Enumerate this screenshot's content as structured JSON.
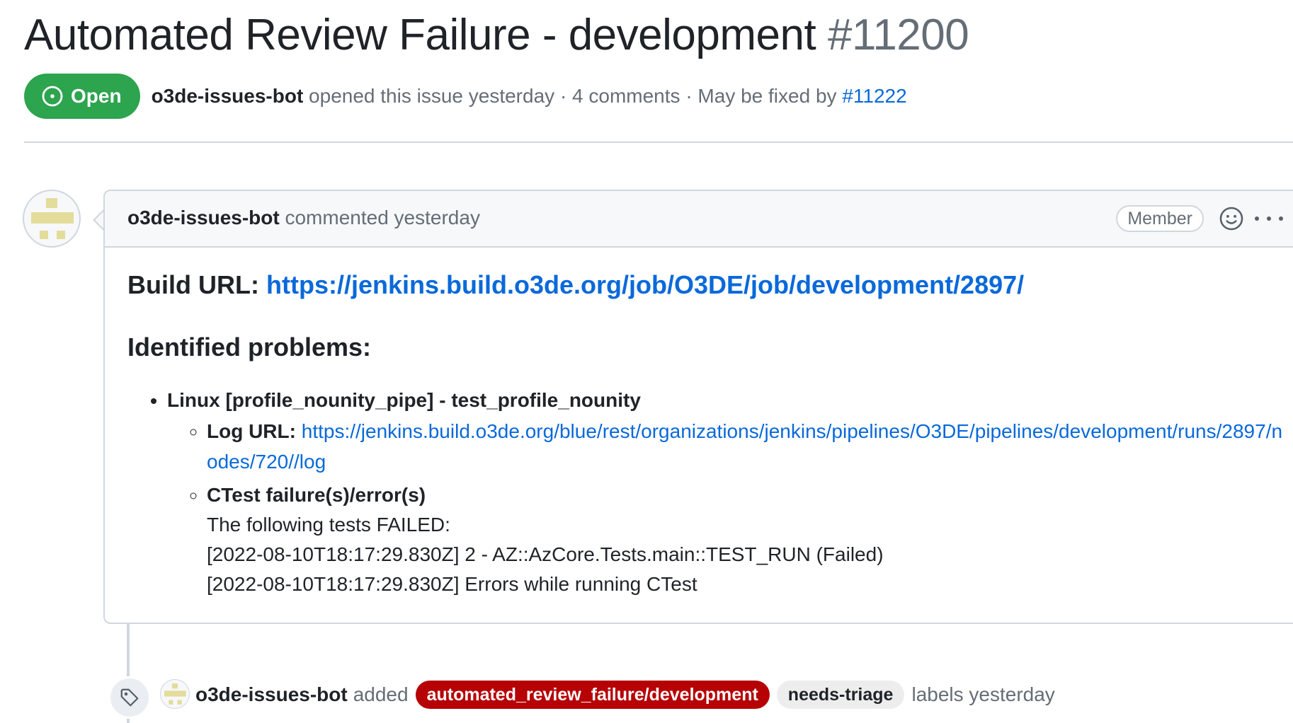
{
  "issue": {
    "title": "Automated Review Failure - development",
    "number": "#11200",
    "state": "Open",
    "author": "o3de-issues-bot",
    "opened_text": "opened this issue yesterday",
    "comments_text": "· 4 comments ·",
    "fixed_text": "May be fixed by",
    "fixed_pr": "#11222"
  },
  "comment": {
    "author": "o3de-issues-bot",
    "action": "commented yesterday",
    "role_badge": "Member",
    "build_url_label": "Build URL:",
    "build_url": "https://jenkins.build.o3de.org/job/O3DE/job/development/2897/",
    "problems_heading": "Identified problems:",
    "problem": {
      "title": "Linux [profile_nounity_pipe] - test_profile_nounity",
      "log_label": "Log URL:",
      "log_url": "https://jenkins.build.o3de.org/blue/rest/organizations/jenkins/pipelines/O3DE/pipelines/development/runs/2897/nodes/720//log",
      "ctest_label": "CTest failure(s)/error(s)",
      "ctest_lines": [
        "The following tests FAILED:",
        "[2022-08-10T18:17:29.830Z] 2 - AZ::AzCore.Tests.main::TEST_RUN (Failed)",
        "[2022-08-10T18:17:29.830Z] Errors while running CTest"
      ]
    }
  },
  "event": {
    "author": "o3de-issues-bot",
    "action": "added",
    "labels": [
      {
        "name": "automated_review_failure/development",
        "color": "#b60205"
      },
      {
        "name": "needs-triage",
        "color": "#ededed"
      }
    ],
    "trail": "labels yesterday"
  },
  "colors": {
    "open_green": "#2da44e",
    "link_blue": "#0969da",
    "muted_text": "#656d76",
    "avatar_khaki": "#e3dc9a"
  },
  "icons": [
    "issue-opened-icon",
    "avatar-identicon",
    "smiley-icon",
    "kebab-horizontal-icon",
    "tag-icon"
  ]
}
